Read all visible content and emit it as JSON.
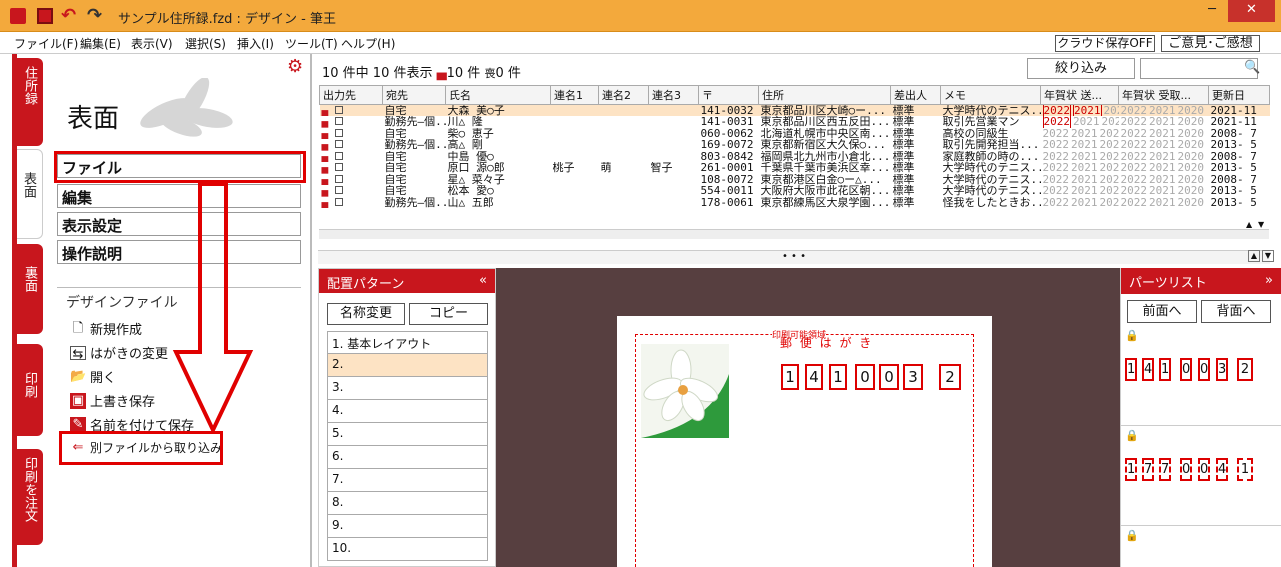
{
  "window": {
    "title": "サンプル住所録.fzd : デザイン - 筆王",
    "min_label": "─",
    "close_label": "✕"
  },
  "menu": [
    {
      "label": "ファイル(F)"
    },
    {
      "label": "編集(E)"
    },
    {
      "label": "表示(V)"
    },
    {
      "label": "選択(S)"
    },
    {
      "label": "挿入(I)"
    },
    {
      "label": "ツール(T)"
    },
    {
      "label": "ヘルプ(H)"
    }
  ],
  "top_buttons": {
    "cloud": "クラウド保存OFF",
    "feedback": "ご意見･ご感想"
  },
  "left_tabs": [
    {
      "label": "住所録"
    },
    {
      "label": "表面"
    },
    {
      "label": "裏面"
    },
    {
      "label": "印刷"
    },
    {
      "label": "印刷を注文"
    }
  ],
  "left_panel": {
    "title": "表面",
    "nav": [
      {
        "label": "ファイル"
      },
      {
        "label": "編集"
      },
      {
        "label": "表示設定"
      },
      {
        "label": "操作説明"
      }
    ],
    "section_title": "デザインファイル",
    "file_items": [
      {
        "label": "新規作成",
        "icon": "new-file-icon"
      },
      {
        "label": "はがきの変更",
        "icon": "postcard-change-icon"
      },
      {
        "label": "開く",
        "icon": "folder-open-icon"
      },
      {
        "label": "上書き保存",
        "icon": "save-icon"
      },
      {
        "label": "名前を付けて保存",
        "icon": "save-as-icon"
      },
      {
        "label": "別ファイルから取り込み",
        "icon": "import-icon"
      }
    ]
  },
  "grid": {
    "summary_count": "10 件中 10 件表示",
    "summary_print": "10 件",
    "summary_mourning": "0 件",
    "mourning_mark": "喪",
    "filter_button": "絞り込み",
    "search_placeholder": "",
    "columns": [
      "出力先",
      "宛先",
      "氏名",
      "連名1",
      "連名2",
      "連名3",
      "〒",
      "住所",
      "差出人",
      "メモ",
      "年賀状 送...",
      "年賀状 受取...",
      "更新日"
    ],
    "rows": [
      {
        "dest": "自宅",
        "name": "大森 美○子",
        "r1": "",
        "r2": "",
        "r3": "",
        "zip": "141-0032",
        "addr": "東京都品川区大崎○ー...",
        "sender": "標準",
        "memo": "大学時代のテニス...",
        "y1": "2022",
        "y2": "2021",
        "y3": "202",
        "sent_on": [
          true,
          true
        ],
        "upd": "2021-11"
      },
      {
        "dest": "勤務先―個...",
        "name": "川△ 隆",
        "r1": "",
        "r2": "",
        "r3": "",
        "zip": "141-0031",
        "addr": "東京都品川区西五反田...",
        "sender": "標準",
        "memo": "取引先営業マン",
        "y1": "2022",
        "y2": "2021",
        "y3": "202",
        "sent_on": [
          true,
          false
        ],
        "upd": "2021-11"
      },
      {
        "dest": "自宅",
        "name": "柴○ 恵子",
        "r1": "",
        "r2": "",
        "r3": "",
        "zip": "060-0062",
        "addr": "北海道札幌市中央区南...",
        "sender": "標準",
        "memo": "高校の同級生",
        "y1": "2022",
        "y2": "2021",
        "y3": "202",
        "sent_on": [
          false,
          false
        ],
        "upd": "2008- 7"
      },
      {
        "dest": "勤務先―個...",
        "name": "高△ 剛",
        "r1": "",
        "r2": "",
        "r3": "",
        "zip": "169-0072",
        "addr": "東京都新宿区大久保○...",
        "sender": "標準",
        "memo": "取引先開発担当...",
        "y1": "2022",
        "y2": "2021",
        "y3": "202",
        "sent_on": [
          false,
          false
        ],
        "upd": "2013- 5"
      },
      {
        "dest": "自宅",
        "name": "中島 優○",
        "r1": "",
        "r2": "",
        "r3": "",
        "zip": "803-0842",
        "addr": "福岡県北九州市小倉北...",
        "sender": "標準",
        "memo": "家庭教師の時の...",
        "y1": "2022",
        "y2": "2021",
        "y3": "202",
        "sent_on": [
          false,
          false
        ],
        "upd": "2008- 7"
      },
      {
        "dest": "自宅",
        "name": "原口 源○郎",
        "r1": "桃子",
        "r2": "萌",
        "r3": "智子",
        "zip": "261-0001",
        "addr": "千葉県千葉市美浜区幸...",
        "sender": "標準",
        "memo": "大学時代のテニス...",
        "y1": "2022",
        "y2": "2021",
        "y3": "202",
        "sent_on": [
          false,
          false
        ],
        "upd": "2013- 5"
      },
      {
        "dest": "自宅",
        "name": "星△ 菜々子",
        "r1": "",
        "r2": "",
        "r3": "",
        "zip": "108-0072",
        "addr": "東京都港区白金○ー△...",
        "sender": "標準",
        "memo": "大学時代のテニス...",
        "y1": "2022",
        "y2": "2021",
        "y3": "202",
        "sent_on": [
          false,
          false
        ],
        "upd": "2008- 7"
      },
      {
        "dest": "自宅",
        "name": "松本 愛○",
        "r1": "",
        "r2": "",
        "r3": "",
        "zip": "554-0011",
        "addr": "大阪府大阪市此花区朝...",
        "sender": "標準",
        "memo": "大学時代のテニス...",
        "y1": "2022",
        "y2": "2021",
        "y3": "202",
        "sent_on": [
          false,
          false
        ],
        "upd": "2013- 5"
      },
      {
        "dest": "勤務先―個...",
        "name": "山△ 五郎",
        "r1": "",
        "r2": "",
        "r3": "",
        "zip": "178-0061",
        "addr": "東京都練馬区大泉学園...",
        "sender": "標準",
        "memo": "怪我をしたときお...",
        "y1": "2022",
        "y2": "2021",
        "y3": "202",
        "sent_on": [
          false,
          false
        ],
        "upd": "2013- 5"
      }
    ],
    "receive_years": [
      "2022",
      "2021",
      "2020"
    ]
  },
  "pattern_panel": {
    "title": "配置パターン",
    "rename_button": "名称変更",
    "copy_button": "コピー",
    "items": [
      "1. 基本レイアウト",
      "2.",
      "3.",
      "4.",
      "5.",
      "6.",
      "7.",
      "8.",
      "9.",
      "10."
    ]
  },
  "card": {
    "print_area_label": "印刷可能領域",
    "postcard_label": "郵 便 は が き",
    "zip_digits": [
      "1",
      "4",
      "1",
      "0",
      "0",
      "3",
      "2"
    ]
  },
  "parts_panel": {
    "title": "パーツリスト",
    "front_button": "前面へ",
    "back_button": "背面へ",
    "zip1": [
      "1",
      "4",
      "1",
      "0",
      "0",
      "3",
      "2"
    ],
    "zip2": [
      "1",
      "7",
      "7",
      "0",
      "0",
      "4",
      "1"
    ]
  },
  "splitter_label": "• • •",
  "colors": {
    "accent": "#c8161d",
    "titlebar": "#f3a93c",
    "highlight": "#e00000"
  }
}
